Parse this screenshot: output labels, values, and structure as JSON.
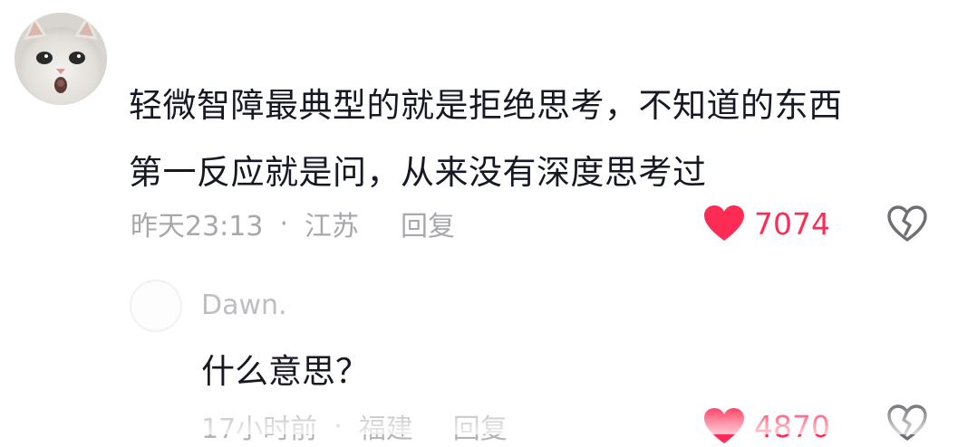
{
  "comment": {
    "avatar_icon": "cat-avatar",
    "text_lines": [
      "轻微智障最典型的就是拒绝思考，不知道的东西",
      "第一反应就是问，从来没有深度思考过"
    ],
    "time": "昨天23:13",
    "separator": "·",
    "location": "江苏",
    "reply_label": "回复",
    "like_count": "7074",
    "like_icon": "heart-icon",
    "dislike_icon": "broken-heart-icon"
  },
  "reply": {
    "username": "Dawn.",
    "text": "什么意思？",
    "time": "17小时前",
    "separator": "·",
    "location": "福建",
    "reply_label": "回复",
    "like_count": "4870"
  },
  "colors": {
    "accent_red": "#fe2c55",
    "text_primary": "#161823",
    "text_secondary": "#a7a8ad"
  }
}
